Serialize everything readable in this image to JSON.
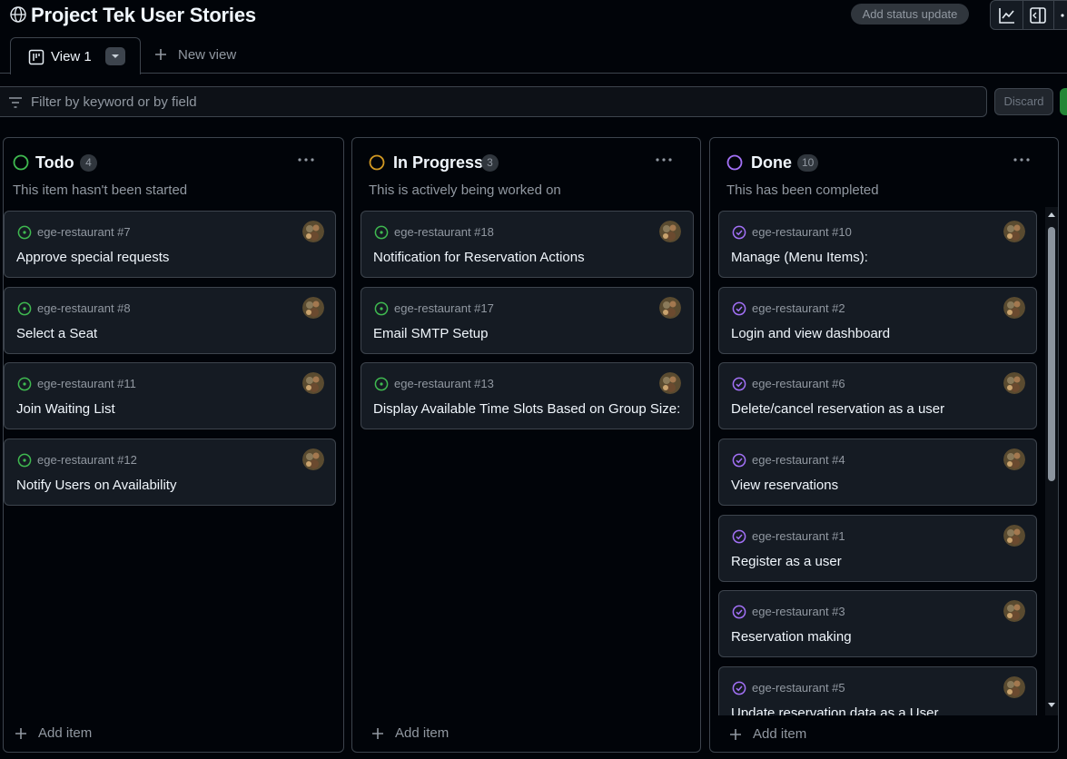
{
  "header": {
    "title": "Project Tek User Stories",
    "status_update_label": "Add status update"
  },
  "tabs": {
    "active_label": "View 1",
    "new_view_label": "New view"
  },
  "filter": {
    "placeholder": "Filter by keyword or by field",
    "discard_label": "Discard"
  },
  "colors": {
    "todo": "#3fb950",
    "in_progress": "#d29922",
    "done": "#a371f7",
    "save": "#238636"
  },
  "columns": [
    {
      "name": "Todo",
      "count": "4",
      "description": "This item hasn't been started",
      "status_icon": "circle-outline-icon",
      "cards": [
        {
          "ref": "ege-restaurant #7",
          "title": "Approve special requests"
        },
        {
          "ref": "ege-restaurant #8",
          "title": "Select a Seat"
        },
        {
          "ref": "ege-restaurant #11",
          "title": "Join Waiting List"
        },
        {
          "ref": "ege-restaurant #12",
          "title": "Notify Users on Availability"
        }
      ],
      "add_item_label": "Add item"
    },
    {
      "name": "In Progress",
      "count": "3",
      "description": "This is actively being worked on",
      "status_icon": "circle-outline-icon",
      "cards": [
        {
          "ref": "ege-restaurant #18",
          "title": "Notification for Reservation Actions"
        },
        {
          "ref": "ege-restaurant #17",
          "title": "Email SMTP Setup"
        },
        {
          "ref": "ege-restaurant #13",
          "title": "Display Available Time Slots Based on Group Size:"
        }
      ],
      "add_item_label": "Add item"
    },
    {
      "name": "Done",
      "count": "10",
      "description": "This has been completed",
      "status_icon": "circle-outline-icon",
      "cards": [
        {
          "ref": "ege-restaurant #10",
          "title": "Manage (Menu Items):"
        },
        {
          "ref": "ege-restaurant #2",
          "title": "Login and view dashboard"
        },
        {
          "ref": "ege-restaurant #6",
          "title": "Delete/cancel reservation as a user"
        },
        {
          "ref": "ege-restaurant #4",
          "title": "View reservations"
        },
        {
          "ref": "ege-restaurant #1",
          "title": "Register as a user"
        },
        {
          "ref": "ege-restaurant #3",
          "title": "Reservation making"
        },
        {
          "ref": "ege-restaurant #5",
          "title": "Update reservation data as a User"
        }
      ],
      "add_item_label": "Add item"
    }
  ]
}
